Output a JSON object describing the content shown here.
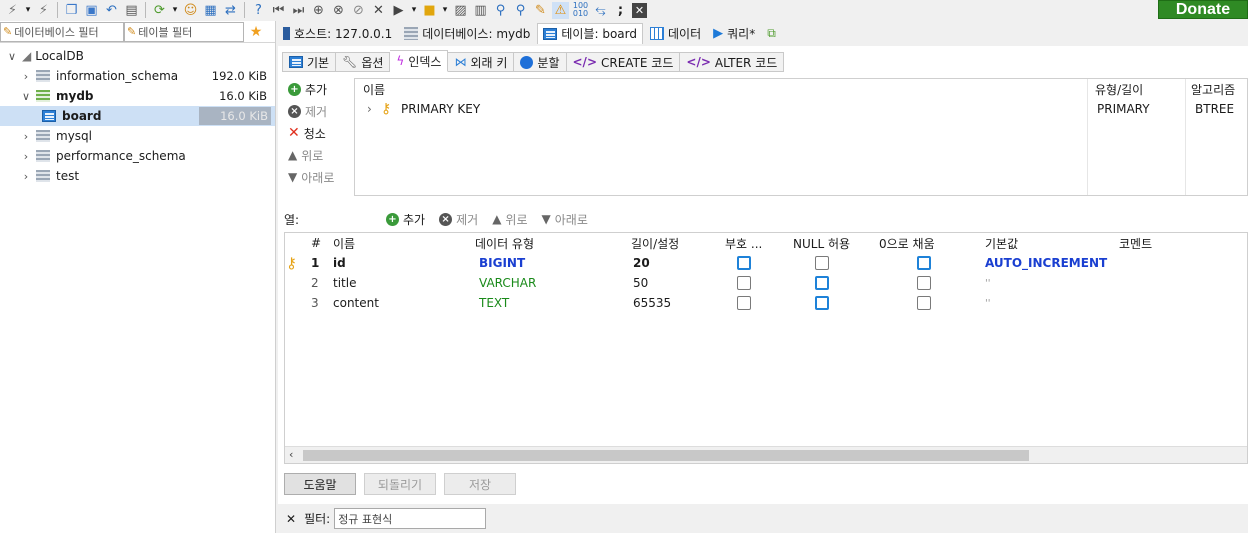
{
  "toolbar": {
    "icons": [
      "connect-icon",
      "dropdown-icon",
      "disconnect-icon",
      "copy-icon",
      "paste-icon",
      "undo-icon",
      "print-icon",
      "refresh-icon",
      "dropdown-icon",
      "user-manager-icon",
      "export-icon",
      "sync-icon",
      "help-icon",
      "first-icon",
      "last-icon",
      "add-icon",
      "delete-icon",
      "check-icon",
      "cancel-icon",
      "run-icon",
      "dropdown-icon",
      "folder-icon",
      "dropdown-icon",
      "save-icon",
      "stop-icon",
      "find-icon",
      "find-replace-icon",
      "broom-icon",
      "warning-icon",
      "binary-icon",
      "wrap-icon",
      "semicolon-icon",
      "close-tab-icon"
    ],
    "donate_label": "Donate",
    "donate_color": "#2f8a24"
  },
  "left": {
    "db_filter_placeholder": "데이터베이스 필터",
    "table_filter_placeholder": "테이블 필터",
    "tree": [
      {
        "label": "LocalDB",
        "size": "",
        "level": 0,
        "expanded": true
      },
      {
        "label": "information_schema",
        "size": "192.0 KiB",
        "level": 1
      },
      {
        "label": "mydb",
        "size": "16.0 KiB",
        "level": 1,
        "expanded": true
      },
      {
        "label": "board",
        "size": "16.0 KiB",
        "level": 2,
        "selected": true
      },
      {
        "label": "mysql",
        "size": "",
        "level": 1
      },
      {
        "label": "performance_schema",
        "size": "",
        "level": 1
      },
      {
        "label": "test",
        "size": "",
        "level": 1
      }
    ]
  },
  "tabs": [
    {
      "label": "호스트: 127.0.0.1",
      "icon": "host-icon"
    },
    {
      "label": "데이터베이스: mydb",
      "icon": "database-icon"
    },
    {
      "label": "테이블: board",
      "icon": "table-icon",
      "active": true
    },
    {
      "label": "데이터",
      "icon": "data-grid-icon"
    },
    {
      "label": "쿼리*",
      "icon": "query-icon"
    },
    {
      "label": "",
      "icon": "new-query-tab-icon"
    }
  ],
  "subtabs": [
    {
      "label": "기본",
      "icon": "table-icon"
    },
    {
      "label": "옵션",
      "icon": "wrench-icon"
    },
    {
      "label": "인덱스",
      "icon": "lightning-icon",
      "active": true
    },
    {
      "label": "외래 키",
      "icon": "foreign-key-icon"
    },
    {
      "label": "분할",
      "icon": "partition-icon"
    },
    {
      "label": "CREATE 코드",
      "icon": "code-icon"
    },
    {
      "label": "ALTER 코드",
      "icon": "code-icon"
    }
  ],
  "index_actions": [
    {
      "label": "추가",
      "enabled": true,
      "icon": "add-icon"
    },
    {
      "label": "제거",
      "enabled": false,
      "icon": "remove-icon"
    },
    {
      "label": "청소",
      "enabled": true,
      "icon": "clear-icon"
    },
    {
      "label": "위로",
      "enabled": false,
      "icon": "up-icon"
    },
    {
      "label": "아래로",
      "enabled": false,
      "icon": "down-icon"
    }
  ],
  "index_grid": {
    "headers": {
      "name": "이름",
      "type": "유형/길이",
      "algo": "알고리즘"
    },
    "rows": [
      {
        "name": "PRIMARY KEY",
        "type": "PRIMARY",
        "algo": "BTREE"
      }
    ]
  },
  "columns_bar": {
    "label": "열:",
    "add": "추가",
    "remove": "제거",
    "up": "위로",
    "down": "아래로"
  },
  "columns_grid": {
    "headers": {
      "num": "#",
      "name": "이름",
      "type": "데이터 유형",
      "length": "길이/설정",
      "unsigned": "부호 ...",
      "null": "NULL 허용",
      "zerofill": "0으로 채움",
      "default": "기본값",
      "comment": "코멘트"
    },
    "rows": [
      {
        "num": "1",
        "name": "id",
        "type": "BIGINT",
        "length": "20",
        "unsigned": false,
        "allow_null": false,
        "zerofill": false,
        "default": "AUTO_INCREMENT",
        "type_color": "#1a3fd1",
        "pk": true
      },
      {
        "num": "2",
        "name": "title",
        "type": "VARCHAR",
        "length": "50",
        "unsigned": false,
        "allow_null": true,
        "zerofill": false,
        "default": "''",
        "type_color": "#1a8a1a"
      },
      {
        "num": "3",
        "name": "content",
        "type": "TEXT",
        "length": "65535",
        "unsigned": false,
        "allow_null": true,
        "zerofill": false,
        "default": "''",
        "type_color": "#1a8a1a"
      }
    ]
  },
  "buttons": {
    "help": "도움말",
    "revert": "되돌리기",
    "save": "저장"
  },
  "filter_bar": {
    "close": "✕",
    "label": "필터:",
    "placeholder": "정규 표현식"
  }
}
